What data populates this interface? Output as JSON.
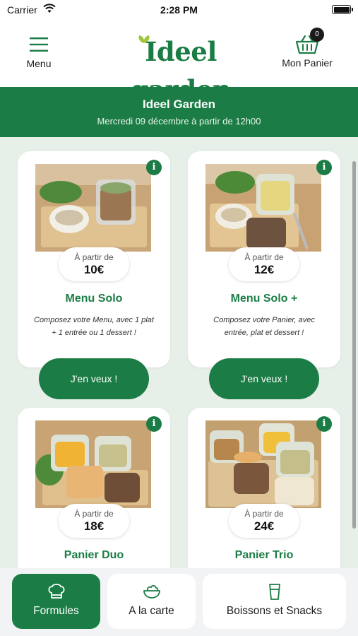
{
  "status_bar": {
    "carrier": "Carrier",
    "time": "2:28 PM"
  },
  "header": {
    "menu_label": "Menu",
    "brand": "Ideel garden",
    "cart_label": "Mon Panier",
    "cart_count": "0"
  },
  "banner": {
    "name": "Ideel Garden",
    "date": "Mercredi 09 décembre à partir de 12h00"
  },
  "products": [
    {
      "title": "Menu Solo",
      "price_from": "À partir de",
      "price": "10€",
      "description_line1": "Composez votre Menu, avec 1 plat",
      "description_line2": "+ 1 entrée ou 1 dessert !",
      "cta": "J'en veux !"
    },
    {
      "title": "Menu Solo +",
      "price_from": "À partir de",
      "price": "12€",
      "description_line1": "Composez votre Panier, avec",
      "description_line2": "entrée, plat et dessert !",
      "cta": "J'en veux !"
    },
    {
      "title": "Panier Duo",
      "price_from": "À partir de",
      "price": "18€"
    },
    {
      "title": "Panier Trio",
      "price_from": "À partir de",
      "price": "24€"
    }
  ],
  "tabs": [
    {
      "label": "Formules",
      "icon": "chef-hat-icon",
      "active": true
    },
    {
      "label": "A la carte",
      "icon": "salad-bowl-icon",
      "active": false
    },
    {
      "label": "Boissons et Snacks",
      "icon": "glass-icon",
      "active": false
    }
  ],
  "colors": {
    "brand_green": "#1b7d45",
    "content_bg": "#e7efe9",
    "tab_bar_bg": "#f1f3f5"
  },
  "info_icon_glyph": "i"
}
